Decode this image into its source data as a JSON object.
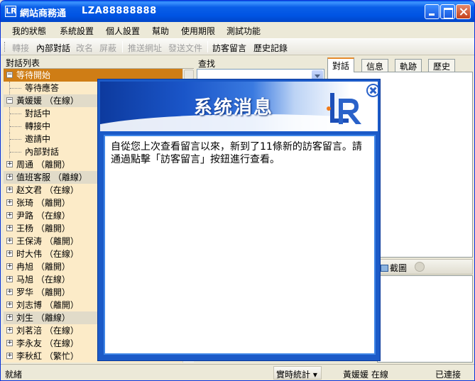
{
  "window": {
    "title": "網站商務通",
    "account_id": "LZA88888888",
    "app_icon_glyph": "LR"
  },
  "menu": [
    "我的狀態",
    "系統設置",
    "個人設置",
    "幫助",
    "使用期限",
    "測試功能"
  ],
  "toolbar": {
    "transfer": "轉接",
    "internal_chat": "內部對話",
    "rename": "改名",
    "block": "屏蔽",
    "push_url": "推送網址",
    "send_file": "發送文件",
    "visitor_messages": "訪客留言",
    "history": "歷史記錄"
  },
  "left_panel": {
    "header": "對話列表",
    "tree": [
      {
        "label": "等待開始",
        "expander": "−",
        "type": "group",
        "state": "selected"
      },
      {
        "label": "等待應答",
        "type": "child"
      },
      {
        "label": "黃媛媛 （在線）",
        "expander": "−",
        "type": "group",
        "state": "grey"
      },
      {
        "label": "對話中",
        "type": "child"
      },
      {
        "label": "轉接中",
        "type": "child"
      },
      {
        "label": "邀請中",
        "type": "child"
      },
      {
        "label": "內部對話",
        "type": "child"
      },
      {
        "label": "周通 （離開）",
        "expander": "+",
        "type": "group"
      },
      {
        "label": "值班客服 （離線）",
        "expander": "+",
        "type": "group",
        "state": "grey"
      },
      {
        "label": "赵文君 （在線）",
        "expander": "+",
        "type": "group"
      },
      {
        "label": "张琦 （離開）",
        "expander": "+",
        "type": "group"
      },
      {
        "label": "尹路 （在線）",
        "expander": "+",
        "type": "group"
      },
      {
        "label": "王杨 （離開）",
        "expander": "+",
        "type": "group"
      },
      {
        "label": "王保涛 （離開）",
        "expander": "+",
        "type": "group"
      },
      {
        "label": "时大伟 （在線）",
        "expander": "+",
        "type": "group"
      },
      {
        "label": "冉旭 （離開）",
        "expander": "+",
        "type": "group"
      },
      {
        "label": "马旭 （在線）",
        "expander": "+",
        "type": "group"
      },
      {
        "label": "罗华 （離開）",
        "expander": "+",
        "type": "group"
      },
      {
        "label": "刘志博 （離開）",
        "expander": "+",
        "type": "group"
      },
      {
        "label": "刘生 （離線）",
        "expander": "+",
        "type": "group",
        "state": "grey"
      },
      {
        "label": "刘茗涪 （在線）",
        "expander": "+",
        "type": "group"
      },
      {
        "label": "李永友 （在線）",
        "expander": "+",
        "type": "group"
      },
      {
        "label": "李秋紅 （繁忙）",
        "expander": "+",
        "type": "group"
      }
    ]
  },
  "search": {
    "label": "查找",
    "value": ""
  },
  "tabs": [
    "對話",
    "信息",
    "軌跡",
    "歷史"
  ],
  "right_toolbar": {
    "screenshot": "截圖"
  },
  "dialog": {
    "title": "系统消息",
    "message": "自從您上次查看留言以來，新到了11條新的訪客留言。請通過點擊「訪客留言」按鈕進行查看。"
  },
  "statusbar": {
    "left": "就緒",
    "stats_dropdown": "實時統計",
    "user_status": "黃媛媛 在線",
    "connection": "已連接"
  },
  "colors": {
    "title_blue": "#0054e3",
    "tree_bg": "#fcebc8",
    "selected_row": "#cf7d15",
    "dialog_blue": "#1b5ac8"
  }
}
